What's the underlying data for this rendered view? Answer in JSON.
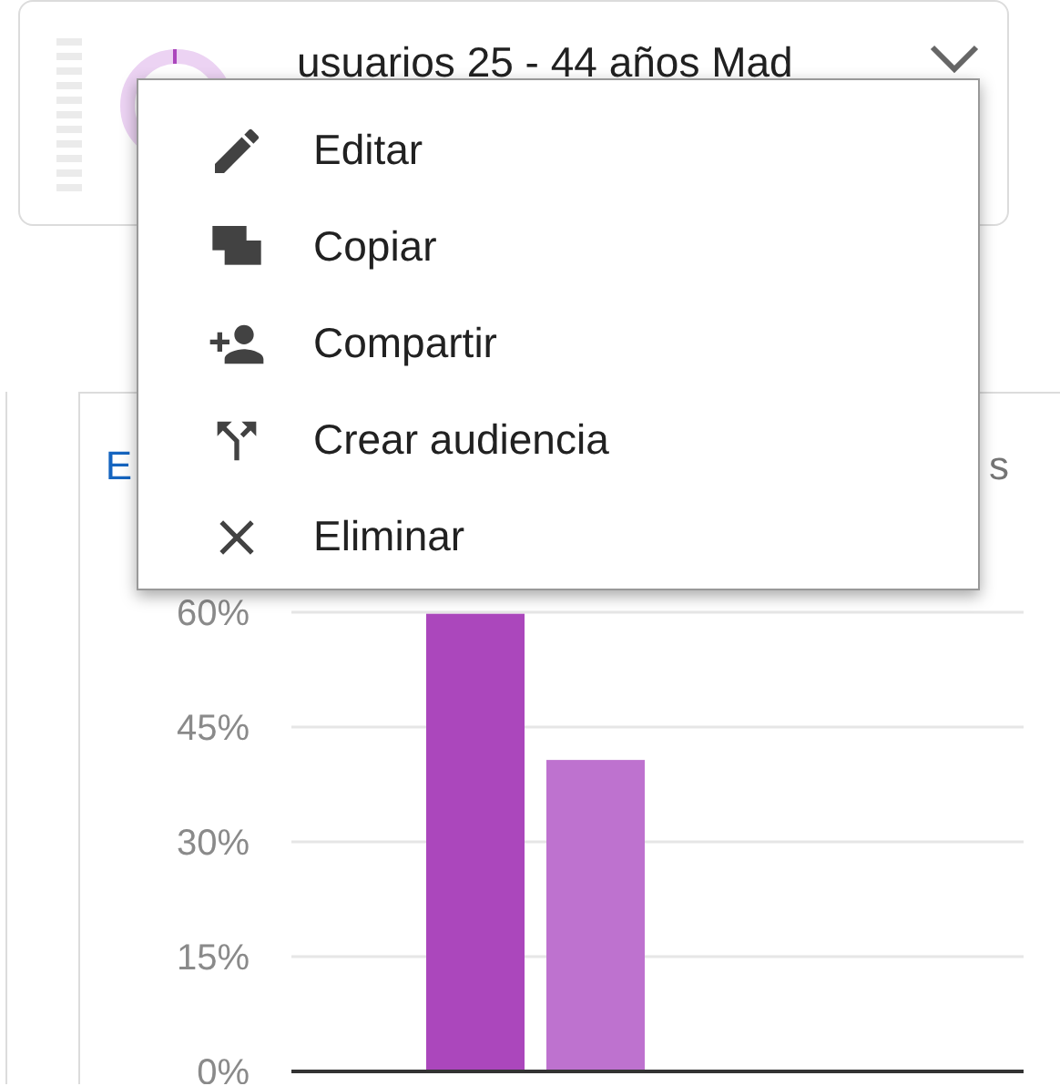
{
  "card": {
    "title": "usuarios 25 - 44 años Mad"
  },
  "menu": {
    "items": [
      {
        "label": "Editar"
      },
      {
        "label": "Copiar"
      },
      {
        "label": "Compartir"
      },
      {
        "label": "Crear audiencia"
      },
      {
        "label": "Eliminar"
      }
    ]
  },
  "chart_panel": {
    "title_start": "E",
    "title_end": "s",
    "chart_data": {
      "type": "bar",
      "grid": true,
      "series": [
        {
          "color": "#ab47bc",
          "values": [
            59.8
          ]
        },
        {
          "color": "#be72cf",
          "values": [
            40.7
          ]
        }
      ],
      "ylim": [
        0,
        60
      ],
      "yticks": [
        {
          "value": 0,
          "label": "0%"
        },
        {
          "value": 15,
          "label": "15%"
        },
        {
          "value": 30,
          "label": "30%"
        },
        {
          "value": 45,
          "label": "45%"
        },
        {
          "value": 60,
          "label": "60%"
        }
      ]
    }
  }
}
